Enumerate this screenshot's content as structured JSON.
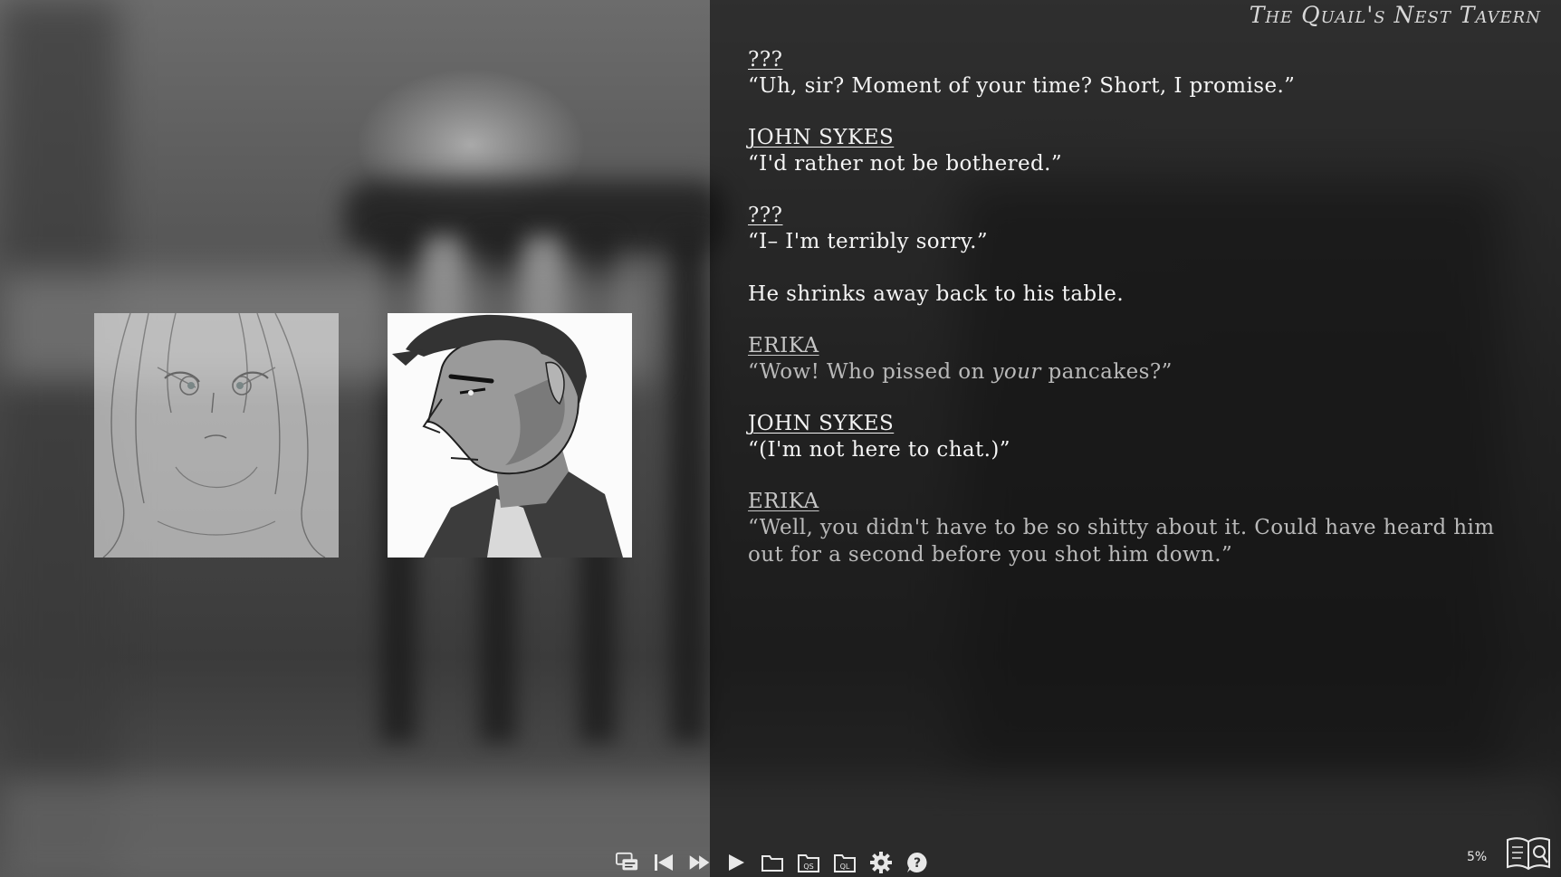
{
  "location": {
    "title": "The Quail's Nest Tavern"
  },
  "log": [
    {
      "speaker": "???",
      "text": "“Uh, sir? Moment of your time? Short, I promise.”",
      "muted": false
    },
    {
      "speaker": "JOHN SYKES",
      "text": "“I'd rather not be bothered.”",
      "muted": false
    },
    {
      "speaker": "???",
      "text": "“I– I'm terribly sorry.”",
      "muted": false
    },
    {
      "speaker": "",
      "text": "He shrinks away back to his table.",
      "muted": false
    },
    {
      "speaker": "ERIKA",
      "text_before": "“Wow! Who pissed on ",
      "text_em": "your",
      "text_after": " pancakes?”",
      "muted": true
    },
    {
      "speaker": "JOHN SYKES",
      "text": "“(I'm not here to chat.)”",
      "muted": false
    },
    {
      "speaker": "ERIKA",
      "text": "“Well, you didn't have to be so shitty about it. Could have heard him out for a second before you shot him down.”",
      "muted": true
    }
  ],
  "toolbar": {
    "buttons": [
      {
        "name": "history-icon"
      },
      {
        "name": "rewind-icon"
      },
      {
        "name": "skip-icon"
      },
      {
        "name": "auto-play-icon"
      },
      {
        "name": "folder-icon"
      },
      {
        "name": "quick-save-icon",
        "label": "QS"
      },
      {
        "name": "quick-load-icon",
        "label": "QL"
      },
      {
        "name": "gear-icon"
      },
      {
        "name": "help-icon",
        "label": "?"
      }
    ]
  },
  "progress": {
    "percent_label": "5%"
  },
  "colors": {
    "panel": "#0a0a0a",
    "text": "#f5f5f5",
    "muted_text": "#b9b9b9"
  }
}
